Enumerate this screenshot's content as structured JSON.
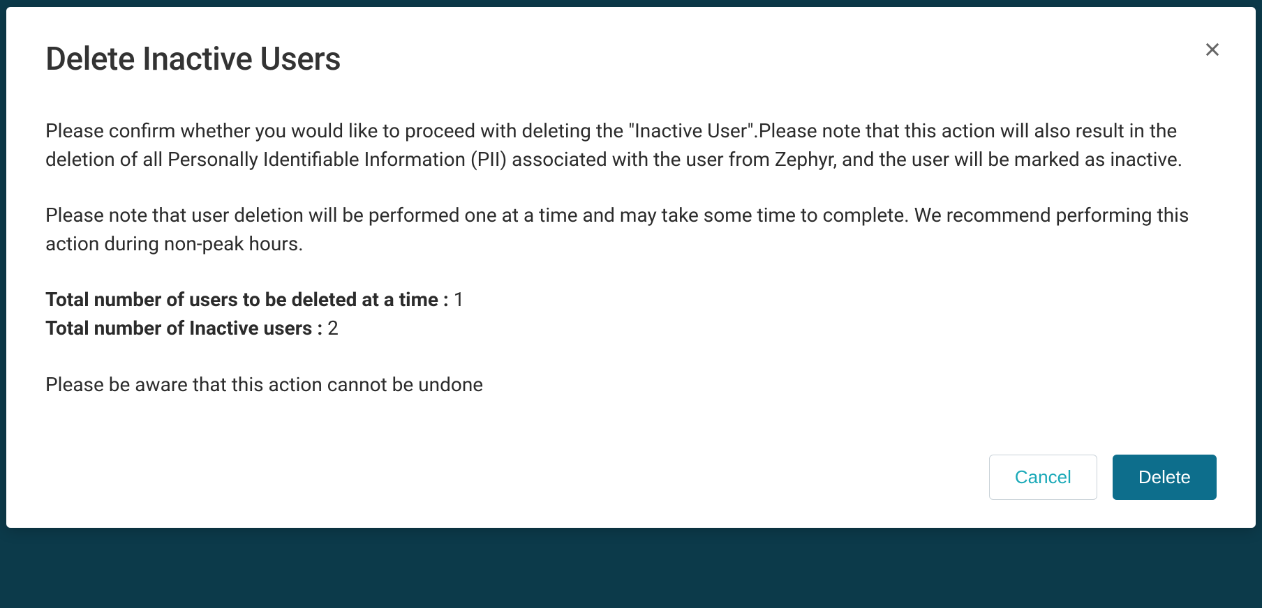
{
  "modal": {
    "title": "Delete Inactive Users",
    "paragraph1": "Please confirm whether you would like to proceed with deleting the \"Inactive User\".Please note that this action will also result in the deletion of all Personally Identifiable Information (PII) associated with the user from Zephyr, and the user will be marked as inactive.",
    "paragraph2": "Please note that user deletion will be performed one at a time and may take some time to complete. We recommend performing this action during non-peak hours.",
    "stats": {
      "batch_label": "Total number of users to be deleted at a time :",
      "batch_value": " 1",
      "inactive_label": "Total number of Inactive users :",
      "inactive_value": " 2"
    },
    "warning": "Please be aware that this action cannot be undone",
    "buttons": {
      "cancel": "Cancel",
      "delete": "Delete"
    }
  }
}
